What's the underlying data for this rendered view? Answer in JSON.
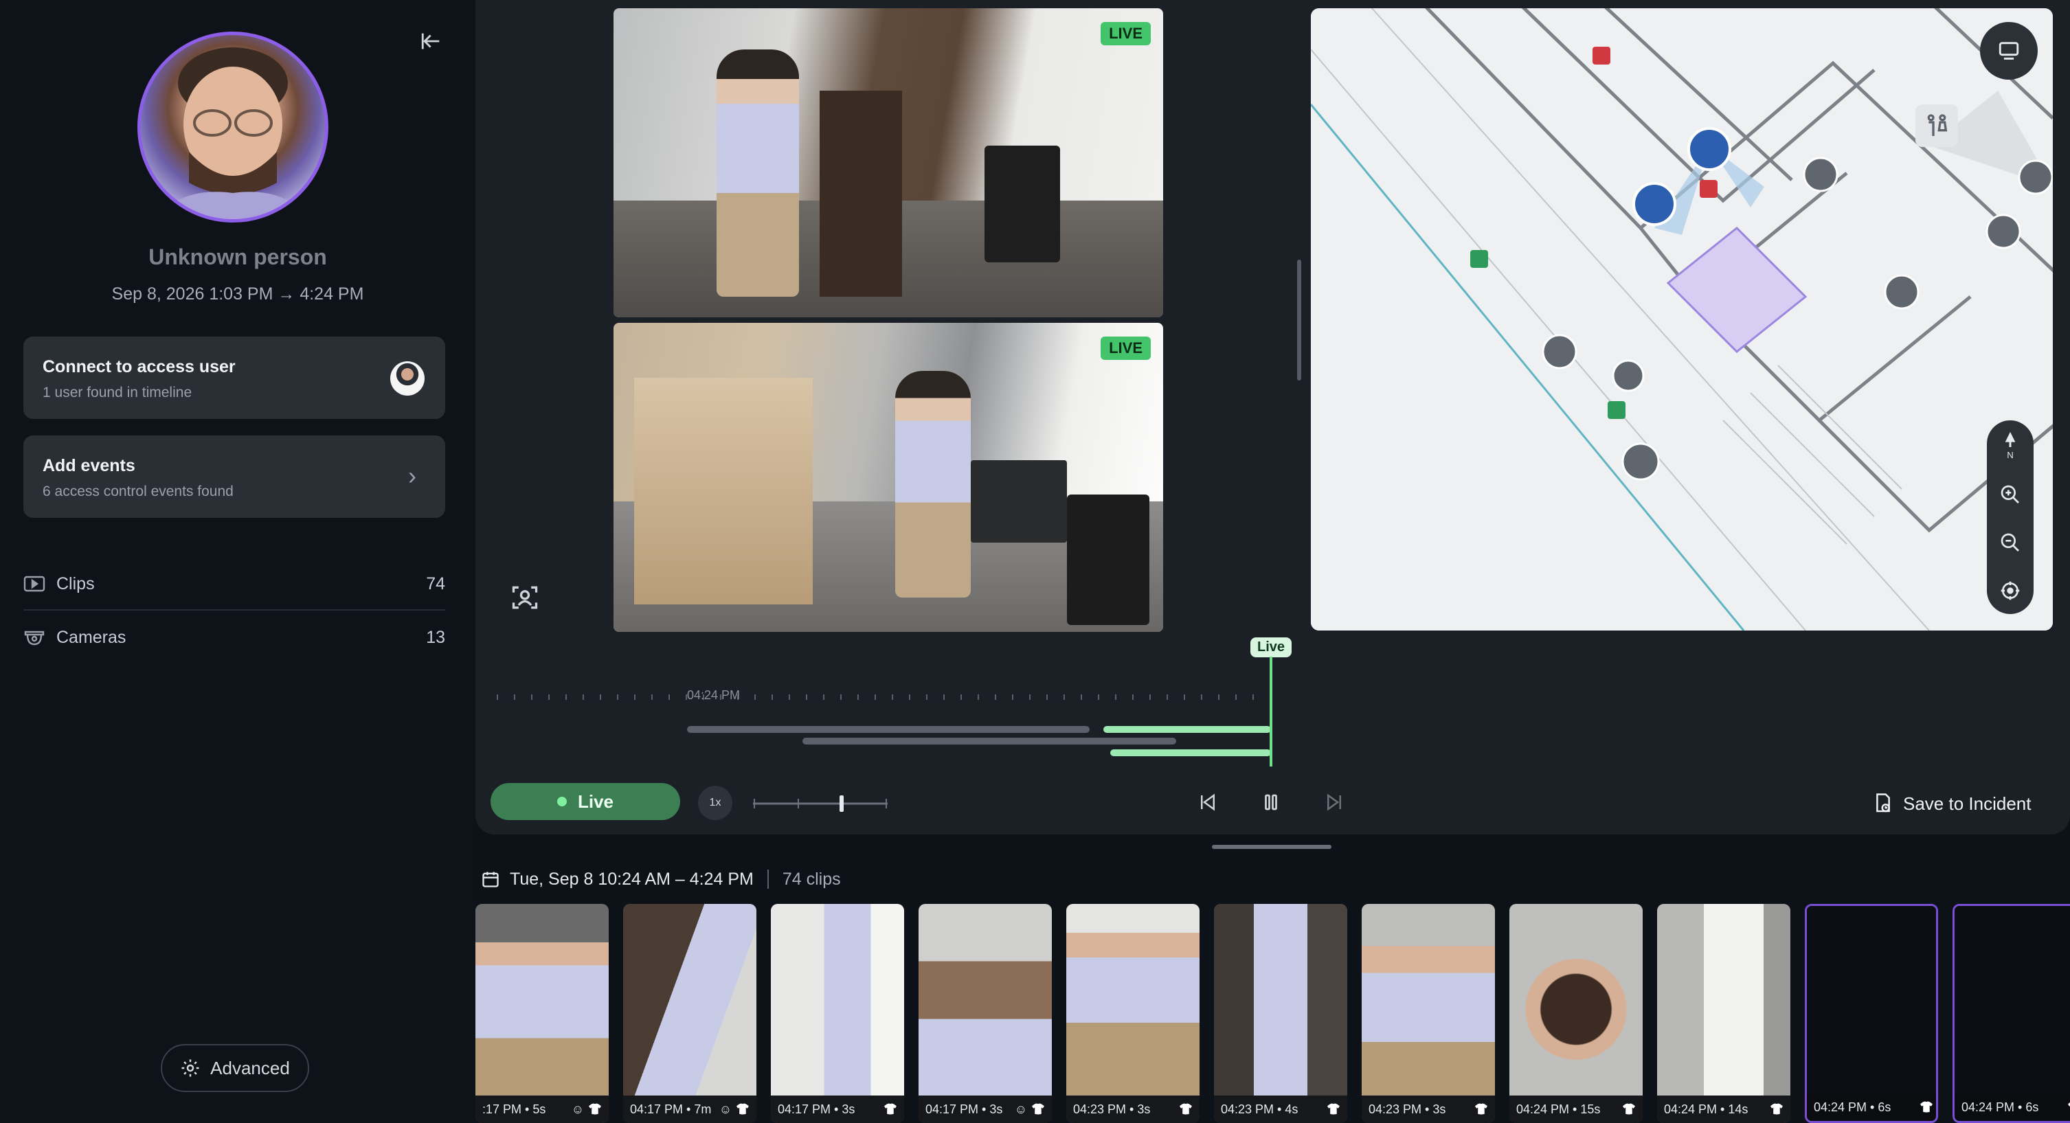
{
  "sidebar": {
    "person_name": "Unknown person",
    "time_range": "Sep 8, 2026 1:03 PM → 4:24 PM",
    "connect_card": {
      "title": "Connect to access user",
      "subtitle": "1 user found in timeline"
    },
    "events_card": {
      "title": "Add events",
      "subtitle": "6 access control events found"
    },
    "rows": [
      {
        "label": "Clips",
        "count": "74",
        "icon": "play-clip-icon"
      },
      {
        "label": "Cameras",
        "count": "13",
        "icon": "dome-camera-icon"
      }
    ],
    "advanced_label": "Advanced"
  },
  "cameras": [
    {
      "badge": "LIVE"
    },
    {
      "badge": "LIVE"
    }
  ],
  "map": {
    "top_button_icon": "camera-layers-icon",
    "restroom_icon": "restroom-icon",
    "compass_label": "N",
    "controls": [
      "compass-north-icon",
      "zoom-in-icon",
      "zoom-out-icon",
      "recenter-icon"
    ]
  },
  "timeline": {
    "live_tag": "Live",
    "tick_label": "04:24 PM"
  },
  "controls": {
    "live_label": "Live",
    "speed_label": "1x",
    "save_label": "Save to Incident"
  },
  "clips": {
    "date_range": "Tue, Sep 8 10:24 AM – 4:24 PM",
    "count_label": "74 clips",
    "items": [
      {
        "caption": ":17 PM • 5s",
        "faces": true
      },
      {
        "caption": "04:17 PM • 7m",
        "faces": true
      },
      {
        "caption": "04:17 PM • 3s",
        "faces": false
      },
      {
        "caption": "04:17 PM • 3s",
        "faces": true
      },
      {
        "caption": "04:23 PM • 3s",
        "faces": false
      },
      {
        "caption": "04:23 PM • 4s",
        "faces": false
      },
      {
        "caption": "04:23 PM • 3s",
        "faces": false
      },
      {
        "caption": "04:24 PM • 15s",
        "faces": false
      },
      {
        "caption": "04:24 PM • 14s",
        "faces": false
      },
      {
        "caption": "04:24 PM • 6s",
        "faces": false
      },
      {
        "caption": "04:24 PM • 6s",
        "faces": false
      }
    ]
  },
  "colors": {
    "accent_purple": "#8d5ee8",
    "live_green": "#43c46b",
    "live_button": "#3b7f53",
    "background": "#0d1218",
    "panel": "#1b2027"
  }
}
